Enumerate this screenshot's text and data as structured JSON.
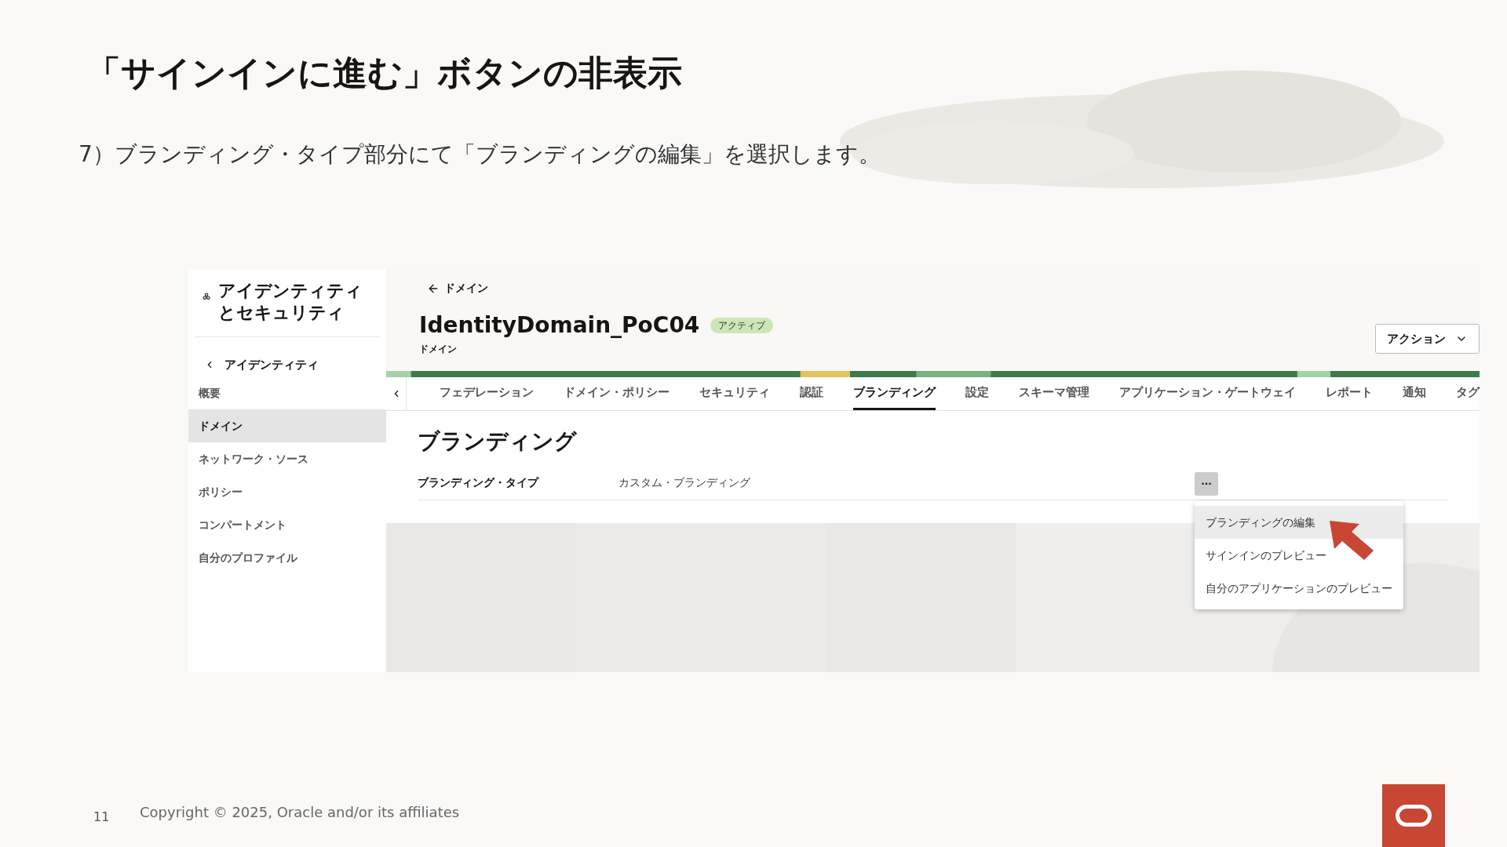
{
  "slide": {
    "title": "「サインインに進む」ボタンの非表示",
    "instruction": "7）ブランディング・タイプ部分にて「ブランディングの編集」を選択します。",
    "page_number": "11",
    "copyright": "Copyright © 2025, Oracle and/or its affiliates"
  },
  "sidebar": {
    "title": "アイデンティティとセキュリティ",
    "back_link": "アイデンティティ",
    "items": [
      {
        "label": "概要",
        "selected": false
      },
      {
        "label": "ドメイン",
        "selected": true
      },
      {
        "label": "ネットワーク・ソース",
        "selected": false
      },
      {
        "label": "ポリシー",
        "selected": false
      },
      {
        "label": "コンパートメント",
        "selected": false
      },
      {
        "label": "自分のプロファイル",
        "selected": false
      }
    ]
  },
  "header": {
    "back_link": "ドメイン",
    "title": "IdentityDomain_PoC04",
    "status": "アクティブ",
    "subtitle": "ドメイン",
    "actions_button": "アクション"
  },
  "tabs": [
    {
      "label": "フェデレーション",
      "selected": false
    },
    {
      "label": "ドメイン・ポリシー",
      "selected": false
    },
    {
      "label": "セキュリティ",
      "selected": false
    },
    {
      "label": "認証",
      "selected": false
    },
    {
      "label": "ブランディング",
      "selected": true
    },
    {
      "label": "設定",
      "selected": false
    },
    {
      "label": "スキーマ管理",
      "selected": false
    },
    {
      "label": "アプリケーション・ゲートウェイ",
      "selected": false
    },
    {
      "label": "レポート",
      "selected": false
    },
    {
      "label": "通知",
      "selected": false
    },
    {
      "label": "タグ",
      "selected": false
    }
  ],
  "content": {
    "heading": "ブランディング",
    "field_label": "ブランディング・タイプ",
    "field_value": "カスタム・ブランディング",
    "more_button": "···",
    "menu": [
      {
        "label": "ブランディングの編集",
        "selected": true
      },
      {
        "label": "サインインのプレビュー",
        "selected": false
      },
      {
        "label": "自分のアプリケーションのプレビュー",
        "selected": false
      }
    ]
  }
}
